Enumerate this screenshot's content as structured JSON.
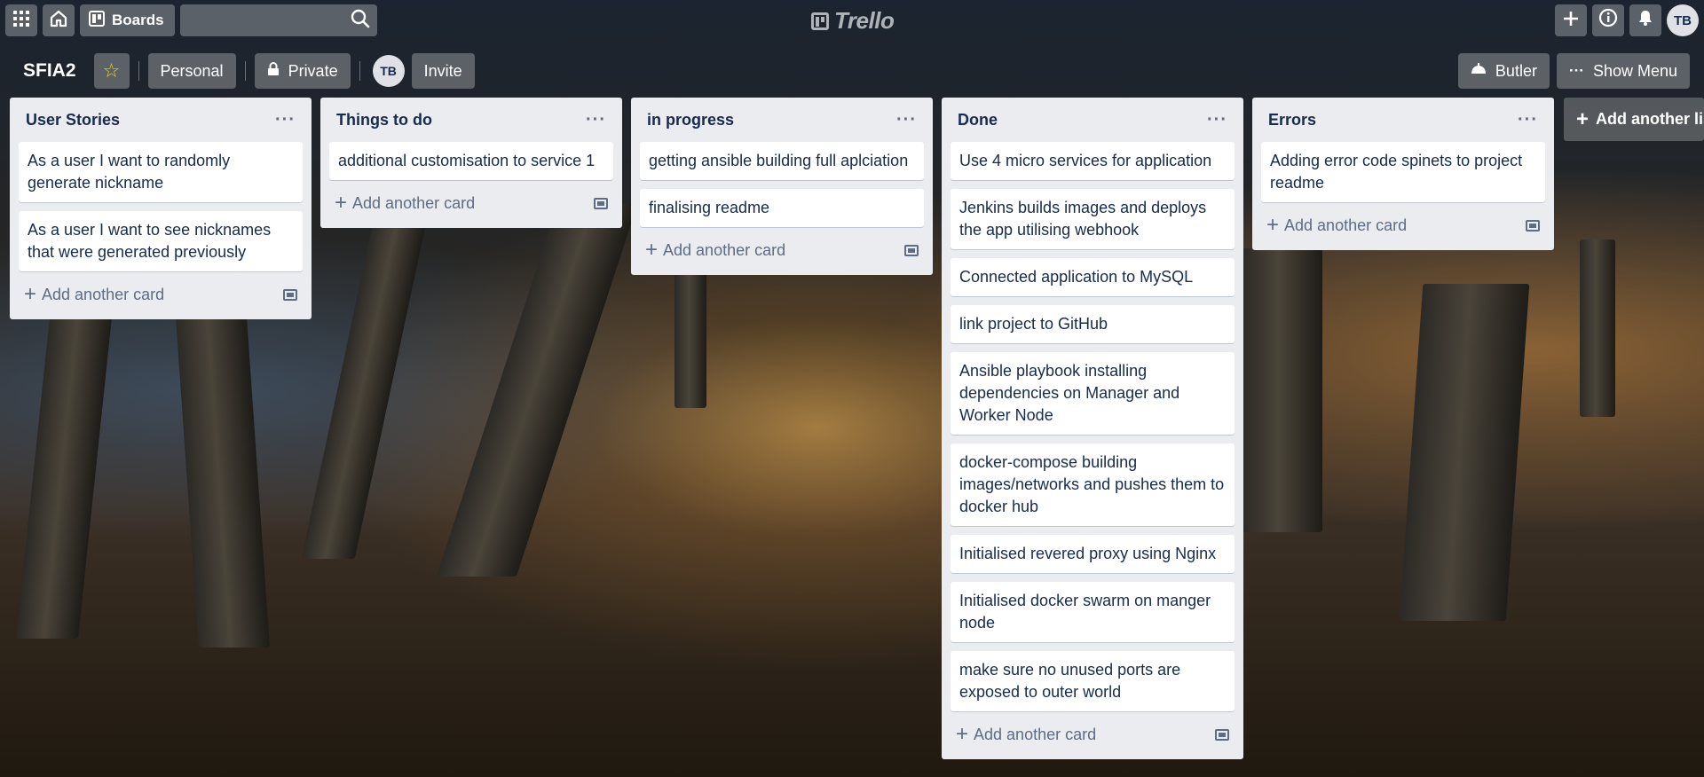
{
  "header": {
    "boards_label": "Boards",
    "logo_text": "Trello",
    "avatar_initials": "TB",
    "icons": [
      "apps-icon",
      "home-icon",
      "boards-icon",
      "search-icon",
      "plus-icon",
      "info-icon",
      "bell-icon"
    ]
  },
  "board": {
    "title": "SFIA2",
    "star_color": "#f2d600",
    "workspace_label": "Personal",
    "visibility_label": "Private",
    "member_initials": "TB",
    "invite_label": "Invite",
    "butler_label": "Butler",
    "show_menu_label": "Show Menu"
  },
  "lists": [
    {
      "title": "User Stories",
      "cards": [
        "As a user I want to randomly generate nickname",
        "As a user I want to see nicknames that were generated previously"
      ],
      "add_card_label": "Add another card"
    },
    {
      "title": "Things to do",
      "cards": [
        "additional customisation to service 1"
      ],
      "add_card_label": "Add another card"
    },
    {
      "title": "in progress",
      "cards": [
        "getting ansible building full aplciation",
        "finalising readme"
      ],
      "add_card_label": "Add another card"
    },
    {
      "title": "Done",
      "cards": [
        "Use 4 micro services for application",
        "Jenkins builds images and deploys the app utilising webhook",
        "Connected application to MySQL",
        "link project to GitHub",
        "Ansible playbook installing dependencies on Manager and Worker Node",
        "docker-compose building images/networks and pushes them to docker hub",
        "Initialised revered proxy using Nginx",
        "Initialised docker swarm on manger node",
        "make sure no unused ports are exposed to outer world"
      ],
      "add_card_label": "Add another card"
    },
    {
      "title": "Errors",
      "cards": [
        "Adding error code spinets to project readme"
      ],
      "add_card_label": "Add another card"
    }
  ],
  "add_list_label": "Add another list",
  "colors": {
    "list_bg": "#ebecf0",
    "card_text": "#172b4d",
    "muted_text": "#5e6c84"
  }
}
